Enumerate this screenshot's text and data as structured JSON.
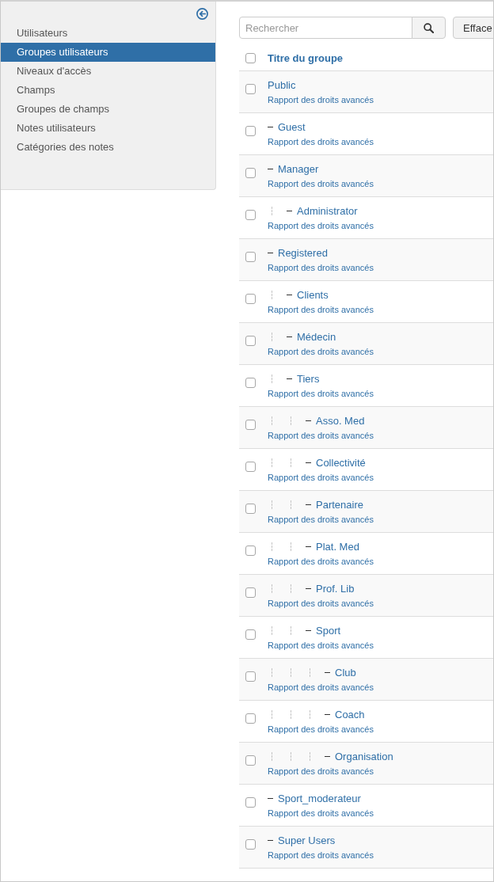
{
  "sidebar": {
    "items": [
      {
        "label": "Utilisateurs",
        "selected": false
      },
      {
        "label": "Groupes utilisateurs",
        "selected": true
      },
      {
        "label": "Niveaux d'accès",
        "selected": false
      },
      {
        "label": "Champs",
        "selected": false
      },
      {
        "label": "Groupes de champs",
        "selected": false
      },
      {
        "label": "Notes utilisateurs",
        "selected": false
      },
      {
        "label": "Catégories des notes",
        "selected": false
      }
    ]
  },
  "toolbar": {
    "search": {
      "placeholder": "Rechercher"
    },
    "clear_button": "Efface"
  },
  "table": {
    "header": {
      "title": "Titre du groupe",
      "checked": false
    },
    "rows": [
      {
        "title": "Public",
        "link": "Rapport des droits avancés",
        "checked": false,
        "children": [
          {
            "title": "Guest",
            "link": "Rapport des droits avancés",
            "checked": false
          },
          {
            "title": "Manager",
            "link": "Rapport des droits avancés",
            "checked": false,
            "children": [
              {
                "title": "Administrator",
                "link": "Rapport des droits avancés",
                "checked": false
              }
            ]
          },
          {
            "title": "Registered",
            "link": "Rapport des droits avancés",
            "checked": false,
            "children": [
              {
                "title": "Clients",
                "link": "Rapport des droits avancés",
                "checked": false
              },
              {
                "title": "Médecin",
                "link": "Rapport des droits avancés",
                "checked": false
              },
              {
                "title": "Tiers",
                "link": "Rapport des droits avancés",
                "checked": false,
                "children": [
                  {
                    "title": "Asso. Med",
                    "link": "Rapport des droits avancés",
                    "checked": false
                  },
                  {
                    "title": "Collectivité",
                    "link": "Rapport des droits avancés",
                    "checked": false
                  },
                  {
                    "title": "Partenaire",
                    "link": "Rapport des droits avancés",
                    "checked": false
                  },
                  {
                    "title": "Plat. Med",
                    "link": "Rapport des droits avancés",
                    "checked": false
                  },
                  {
                    "title": "Prof. Lib",
                    "link": "Rapport des droits avancés",
                    "checked": false
                  },
                  {
                    "title": "Sport",
                    "link": "Rapport des droits avancés",
                    "checked": false,
                    "children": [
                      {
                        "title": "Club",
                        "link": "Rapport des droits avancés",
                        "checked": false
                      },
                      {
                        "title": "Coach",
                        "link": "Rapport des droits avancés",
                        "checked": false
                      },
                      {
                        "title": "Organisation",
                        "link": "Rapport des droits avancés",
                        "checked": false
                      }
                    ]
                  }
                ]
              }
            ]
          },
          {
            "title": "Sport_moderateur",
            "link": "Rapport des droits avancés",
            "checked": false
          },
          {
            "title": "Super Users",
            "link": "Rapport des droits avancés",
            "checked": false
          }
        ]
      }
    ]
  }
}
